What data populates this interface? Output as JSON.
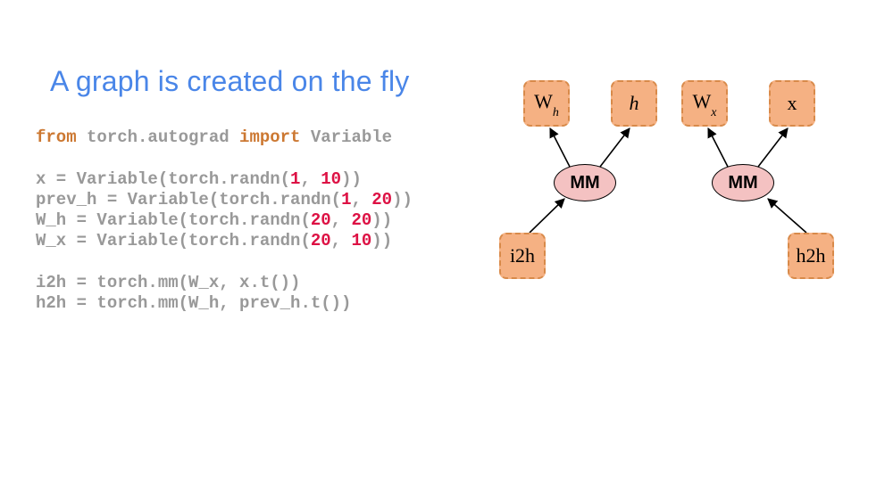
{
  "title": "A graph is created on the fly",
  "code": {
    "l1_from": "from",
    "l1_mod": " torch.autograd ",
    "l1_import": "import",
    "l1_var": " Variable",
    "l3_a": "x = Variable(torch.randn(",
    "l3_n1": "1",
    "l3_c": ", ",
    "l3_n2": "10",
    "l3_e": "))",
    "l4_a": "prev_h = Variable(torch.randn(",
    "l4_n1": "1",
    "l4_c": ", ",
    "l4_n2": "20",
    "l4_e": "))",
    "l5_a": "W_h = Variable(torch.randn(",
    "l5_n1": "20",
    "l5_c": ", ",
    "l5_n2": "20",
    "l5_e": "))",
    "l6_a": "W_x = Variable(torch.randn(",
    "l6_n1": "20",
    "l6_c": ", ",
    "l6_n2": "10",
    "l6_e": "))",
    "l8": "i2h = torch.mm(W_x, x.t())",
    "l9": "h2h = torch.mm(W_h, prev_h.t())"
  },
  "diagram": {
    "wh_main": "W",
    "wh_sub": "h",
    "h": "h",
    "wx_main": "W",
    "wx_sub": "x",
    "x": "x",
    "mm": "MM",
    "i2h": "i2h",
    "h2h": "h2h"
  }
}
